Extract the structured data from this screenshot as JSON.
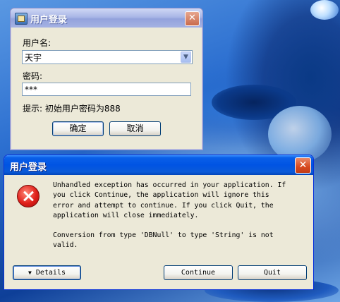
{
  "login_window": {
    "title": "用户登录",
    "username_label": "用户名:",
    "username_value": "天宇",
    "password_label": "密码:",
    "password_value": "***",
    "hint": "提示: 初始用户密码为888",
    "ok_label": "确定",
    "cancel_label": "取消",
    "close_glyph": "✕"
  },
  "error_dialog": {
    "title": "用户登录",
    "close_glyph": "✕",
    "message_lines_1": [
      "Unhandled exception has occurred in your application. If",
      "you click Continue, the application will ignore this",
      "error and attempt to continue. If you click Quit, the",
      "application will close immediately."
    ],
    "message_lines_2": [
      "Conversion from type 'DBNull' to type 'String' is not",
      "valid."
    ],
    "details_label": "Details",
    "details_arrow": "▼",
    "continue_label": "Continue",
    "quit_label": "Quit",
    "icon": "error-icon"
  }
}
